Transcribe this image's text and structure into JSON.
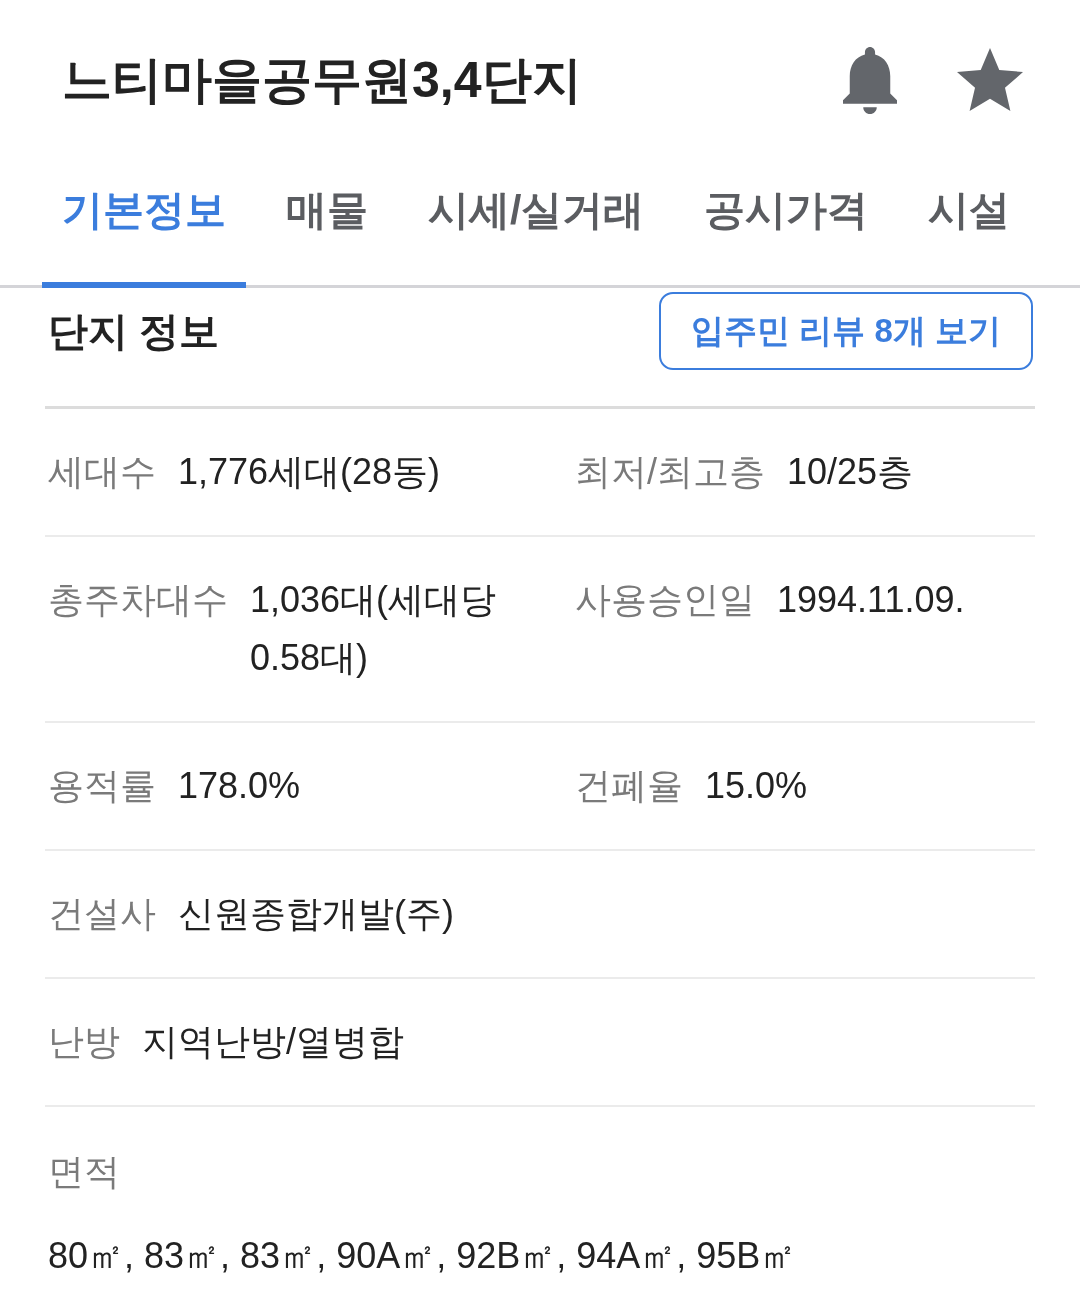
{
  "header": {
    "title": "느티마을공무원3,4단지"
  },
  "tabs": [
    {
      "label": "기본정보",
      "selected": true
    },
    {
      "label": "매물",
      "selected": false
    },
    {
      "label": "시세/실거래",
      "selected": false
    },
    {
      "label": "공시가격",
      "selected": false
    },
    {
      "label": "시설",
      "selected": false
    }
  ],
  "section": {
    "title": "단지 정보",
    "review_button": "입주민 리뷰 8개 보기"
  },
  "rows": [
    {
      "cells": [
        {
          "label": "세대수",
          "value": "1,776세대(28동)"
        },
        {
          "label": "최저/최고층",
          "value": "10/25층"
        }
      ]
    },
    {
      "cells": [
        {
          "label": "총주차대수",
          "value": "1,036대(세대당 0.58대)"
        },
        {
          "label": "사용승인일",
          "value": "1994.11.09."
        }
      ]
    },
    {
      "cells": [
        {
          "label": "용적률",
          "value": "178.0%"
        },
        {
          "label": "건폐율",
          "value": "15.0%"
        }
      ]
    },
    {
      "cells": [
        {
          "label": "건설사",
          "value": "신원종합개발(주)"
        }
      ]
    },
    {
      "cells": [
        {
          "label": "난방",
          "value": "지역난방/열병합"
        }
      ]
    }
  ],
  "area": {
    "label": "면적",
    "value": "80㎡, 83㎡, 83㎡, 90A㎡, 92B㎡, 94A㎡, 95B㎡"
  }
}
